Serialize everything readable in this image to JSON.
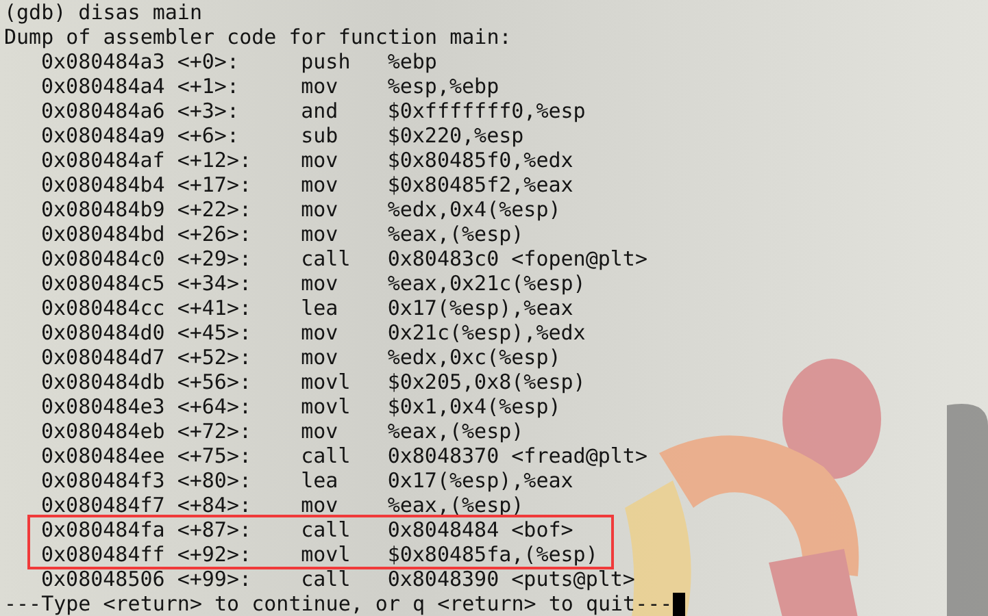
{
  "command": "(gdb) disas main",
  "heading": "Dump of assembler code for function main:",
  "instructions": [
    {
      "address": "0x080484a3",
      "offset": "<+0>:",
      "mnemonic": "push",
      "operands": "%ebp",
      "highlighted": false
    },
    {
      "address": "0x080484a4",
      "offset": "<+1>:",
      "mnemonic": "mov",
      "operands": "%esp,%ebp",
      "highlighted": false
    },
    {
      "address": "0x080484a6",
      "offset": "<+3>:",
      "mnemonic": "and",
      "operands": "$0xfffffff0,%esp",
      "highlighted": false
    },
    {
      "address": "0x080484a9",
      "offset": "<+6>:",
      "mnemonic": "sub",
      "operands": "$0x220,%esp",
      "highlighted": false
    },
    {
      "address": "0x080484af",
      "offset": "<+12>:",
      "mnemonic": "mov",
      "operands": "$0x80485f0,%edx",
      "highlighted": false
    },
    {
      "address": "0x080484b4",
      "offset": "<+17>:",
      "mnemonic": "mov",
      "operands": "$0x80485f2,%eax",
      "highlighted": false
    },
    {
      "address": "0x080484b9",
      "offset": "<+22>:",
      "mnemonic": "mov",
      "operands": "%edx,0x4(%esp)",
      "highlighted": false
    },
    {
      "address": "0x080484bd",
      "offset": "<+26>:",
      "mnemonic": "mov",
      "operands": "%eax,(%esp)",
      "highlighted": false
    },
    {
      "address": "0x080484c0",
      "offset": "<+29>:",
      "mnemonic": "call",
      "operands": "0x80483c0 <fopen@plt>",
      "highlighted": false
    },
    {
      "address": "0x080484c5",
      "offset": "<+34>:",
      "mnemonic": "mov",
      "operands": "%eax,0x21c(%esp)",
      "highlighted": false
    },
    {
      "address": "0x080484cc",
      "offset": "<+41>:",
      "mnemonic": "lea",
      "operands": "0x17(%esp),%eax",
      "highlighted": false
    },
    {
      "address": "0x080484d0",
      "offset": "<+45>:",
      "mnemonic": "mov",
      "operands": "0x21c(%esp),%edx",
      "highlighted": false
    },
    {
      "address": "0x080484d7",
      "offset": "<+52>:",
      "mnemonic": "mov",
      "operands": "%edx,0xc(%esp)",
      "highlighted": false
    },
    {
      "address": "0x080484db",
      "offset": "<+56>:",
      "mnemonic": "movl",
      "operands": "$0x205,0x8(%esp)",
      "highlighted": false
    },
    {
      "address": "0x080484e3",
      "offset": "<+64>:",
      "mnemonic": "movl",
      "operands": "$0x1,0x4(%esp)",
      "highlighted": false
    },
    {
      "address": "0x080484eb",
      "offset": "<+72>:",
      "mnemonic": "mov",
      "operands": "%eax,(%esp)",
      "highlighted": false
    },
    {
      "address": "0x080484ee",
      "offset": "<+75>:",
      "mnemonic": "call",
      "operands": "0x8048370 <fread@plt>",
      "highlighted": false
    },
    {
      "address": "0x080484f3",
      "offset": "<+80>:",
      "mnemonic": "lea",
      "operands": "0x17(%esp),%eax",
      "highlighted": false
    },
    {
      "address": "0x080484f7",
      "offset": "<+84>:",
      "mnemonic": "mov",
      "operands": "%eax,(%esp)",
      "highlighted": false
    },
    {
      "address": "0x080484fa",
      "offset": "<+87>:",
      "mnemonic": "call",
      "operands": "0x8048484 <bof>",
      "highlighted": true
    },
    {
      "address": "0x080484ff",
      "offset": "<+92>:",
      "mnemonic": "movl",
      "operands": "$0x80485fa,(%esp)",
      "highlighted": true
    },
    {
      "address": "0x08048506",
      "offset": "<+99>:",
      "mnemonic": "call",
      "operands": "0x8048390 <puts@plt>",
      "highlighted": false
    }
  ],
  "pager_prompt": "---Type <return> to continue, or q <return> to quit---"
}
